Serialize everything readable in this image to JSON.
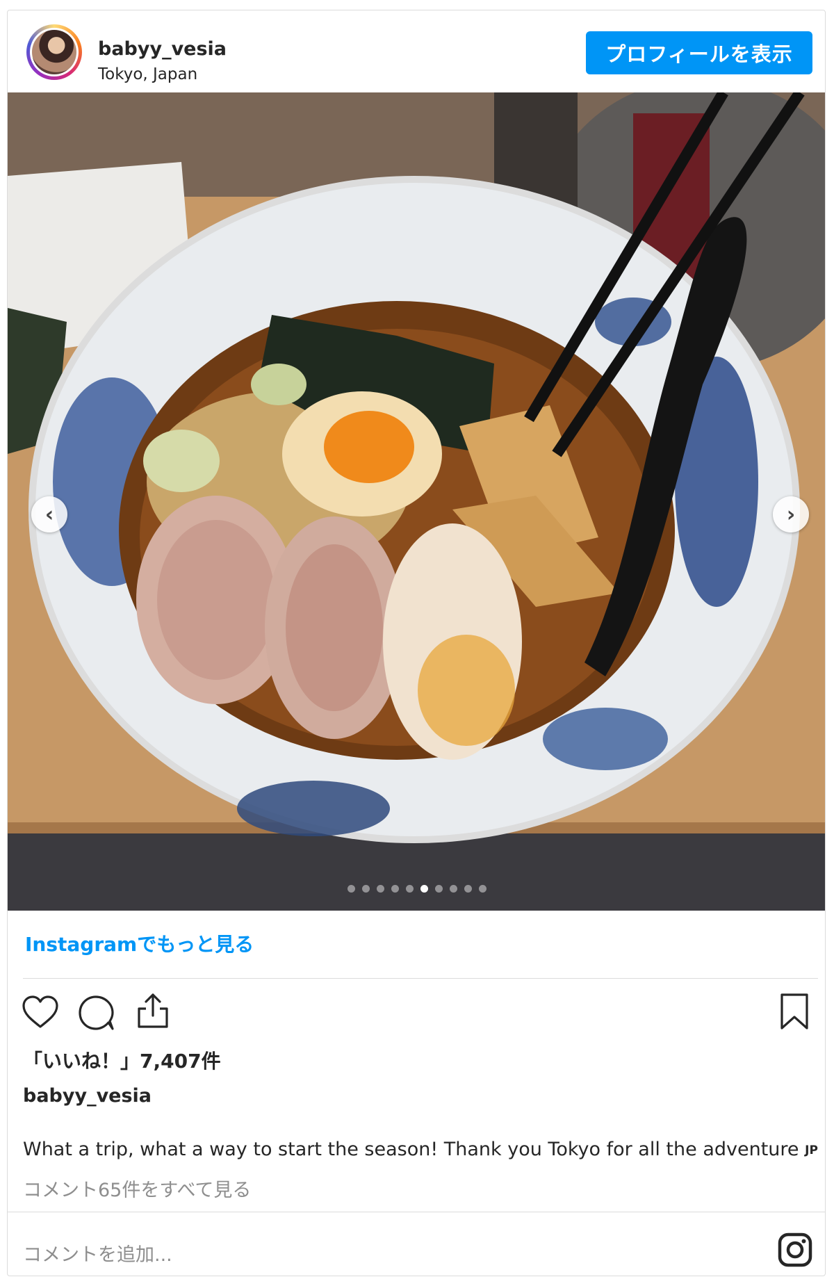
{
  "header": {
    "username": "babyy_vesia",
    "location": "Tokyo, Japan",
    "profile_button": "プロフィールを表示"
  },
  "photo": {
    "subject": "ramen bowl",
    "prev_icon": "chevron-left-icon",
    "next_icon": "chevron-right-icon",
    "carousel_total": 10,
    "carousel_active_index": 5
  },
  "more_link": "Instagramでもっと見る",
  "actions": {
    "like_icon": "heart-icon",
    "comment_icon": "comment-icon",
    "share_icon": "share-icon",
    "save_icon": "bookmark-icon"
  },
  "likes": "「いいね！」7,407件",
  "caption": {
    "username": "babyy_vesia",
    "text": "What a trip, what a way to start the season! Thank you Tokyo for all the adventure ",
    "flag": "JP"
  },
  "view_comments": "コメント65件をすべて見る",
  "add_comment_placeholder": "コメントを追加...",
  "footer_icon": "instagram-logo-icon",
  "colors": {
    "accent": "#0095f6",
    "text": "#262626",
    "muted": "#8e8e8e",
    "border": "#dbdbdb"
  }
}
